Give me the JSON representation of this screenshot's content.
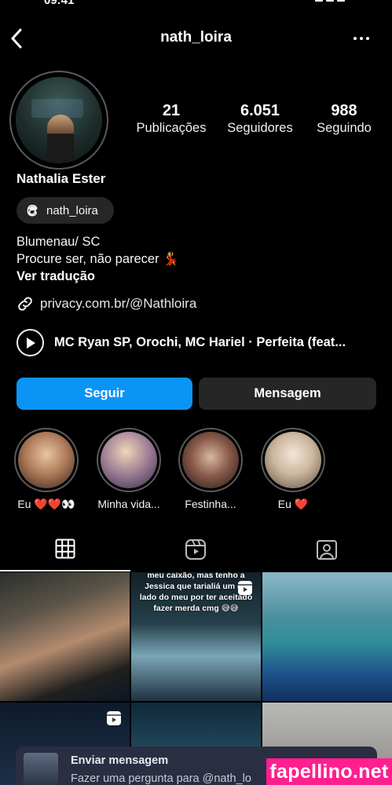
{
  "status_bar": {
    "time": "09:41"
  },
  "header": {
    "username": "nath_loira"
  },
  "profile": {
    "stats": [
      {
        "value": "21",
        "label": "Publicações"
      },
      {
        "value": "6.051",
        "label": "Seguidores"
      },
      {
        "value": "988",
        "label": "Seguindo"
      }
    ],
    "full_name": "Nathalia Ester",
    "threads_handle": "nath_loira",
    "bio_lines": [
      "Blumenau/ SC",
      "Procure ser, não parecer 💃"
    ],
    "translate_label": "Ver tradução",
    "link": "privacy.com.br/@Nathloira",
    "music": "MC Ryan SP, Orochi, MC Hariel · Perfeita (feat..."
  },
  "actions": {
    "follow_label": "Seguir",
    "message_label": "Mensagem"
  },
  "highlights": [
    {
      "label": "Eu ❤️❤️👀"
    },
    {
      "label": "Minha vida..."
    },
    {
      "label": "Festinha..."
    },
    {
      "label": "Eu ❤️"
    }
  ],
  "grid": {
    "post2_caption": "meu caixão, mas tenho a Jessica que tarialiá um do lado do meu por ter aceitado fazer merda cmg 😅😅"
  },
  "dm_prompt": {
    "title": "Enviar mensagem",
    "subtitle": "Fazer uma pergunta para @nath_lo"
  },
  "watermark": "fapellino.net",
  "colors": {
    "accent": "#0a95f6",
    "secondary_button": "#262626",
    "watermark_bg": "#ff1f8e"
  }
}
